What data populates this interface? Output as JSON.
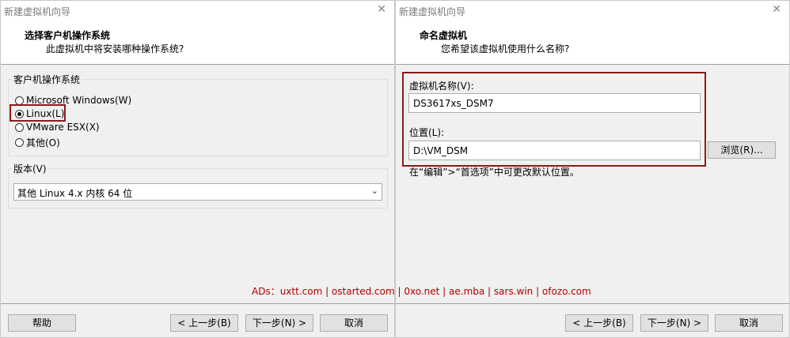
{
  "left": {
    "title": "新建虚拟机向导",
    "header_title": "选择客户机操作系统",
    "header_sub": "此虚拟机中将安装哪种操作系统?",
    "os_group_label": "客户机操作系统",
    "os_options": [
      {
        "label": "Microsoft Windows(W)",
        "checked": false
      },
      {
        "label": "Linux(L)",
        "checked": true
      },
      {
        "label": "VMware ESX(X)",
        "checked": false
      },
      {
        "label": "其他(O)",
        "checked": false
      }
    ],
    "version_group_label": "版本(V)",
    "version_value": "其他 Linux 4.x 内核 64 位",
    "help_label": "帮助",
    "back_label": "< 上一步(B)",
    "next_label": "下一步(N) >",
    "cancel_label": "取消"
  },
  "right": {
    "title": "新建虚拟机向导",
    "header_title": "命名虚拟机",
    "header_sub": "您希望该虚拟机使用什么名称?",
    "name_label": "虚拟机名称(V):",
    "name_value": "DS3617xs_DSM7",
    "location_label": "位置(L):",
    "location_value": "D:\\VM_DSM",
    "browse_label": "浏览(R)...",
    "hint": "在“编辑”>“首选项”中可更改默认位置。",
    "back_label": "< 上一步(B)",
    "next_label": "下一步(N) >",
    "cancel_label": "取消"
  },
  "ads": "ADs：uxtt.com | ostarted.com | 0xo.net | ae.mba | sars.win | ofozo.com",
  "highlight_color": "#8b1a1a"
}
